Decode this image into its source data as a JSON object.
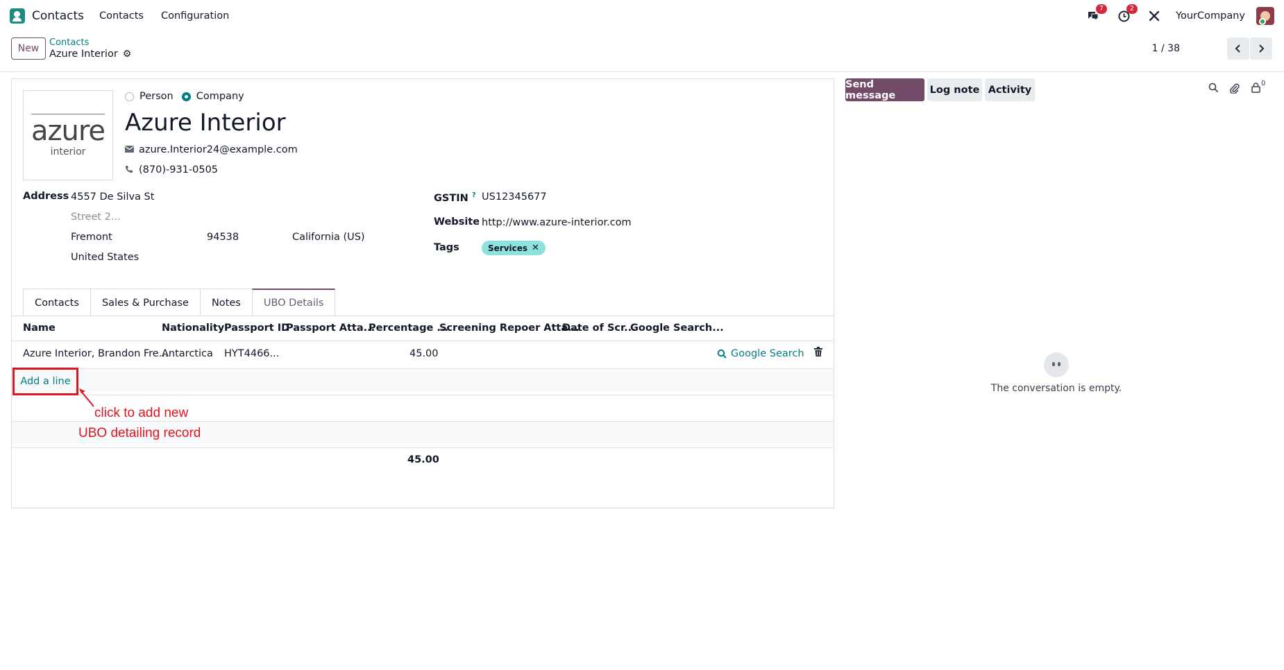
{
  "navbar": {
    "app_name": "Contacts",
    "menus": [
      "Contacts",
      "Configuration"
    ],
    "messages_count": "7",
    "activities_count": "2",
    "company": "YourCompany"
  },
  "control_panel": {
    "new_label": "New",
    "breadcrumb_parent": "Contacts",
    "breadcrumb_current": "Azure Interior",
    "pager": "1 / 38"
  },
  "partner": {
    "logo_word": "azure",
    "logo_sub": "interior",
    "type_options": [
      "Person",
      "Company"
    ],
    "selected_type": "Company",
    "name": "Azure Interior",
    "email": "azure.Interior24@example.com",
    "phone": "(870)-931-0505",
    "address_label": "Address",
    "street": "4557 De Silva St",
    "street2_placeholder": "Street 2...",
    "city": "Fremont",
    "zip": "94538",
    "state": "California (US)",
    "country": "United States",
    "gstin_label": "GSTIN",
    "gstin_help": "?",
    "gstin": "US12345677",
    "website_label": "Website",
    "website": "http://www.azure-interior.com",
    "tags_label": "Tags",
    "tags": [
      "Services"
    ]
  },
  "tabs": [
    "Contacts",
    "Sales & Purchase",
    "Notes",
    "UBO Details"
  ],
  "active_tab": "UBO Details",
  "ubo_table": {
    "columns": [
      "Name",
      "Nationality",
      "Passport ID",
      "Passport Atta...",
      "Percentage ...",
      "Screening Repoer Atta...",
      "Date of Scr...",
      "Google Search..."
    ],
    "rows": [
      {
        "name": "Azure Interior, Brandon Fre...",
        "nationality": "Antarctica",
        "passport_id": "HYT4466...",
        "percentage": "45.00",
        "google_search": "Google Search"
      }
    ],
    "add_line": "Add a line",
    "total_percentage": "45.00"
  },
  "annotation": {
    "line1": "click to add new",
    "line2": "UBO detailing record"
  },
  "chatter": {
    "send_message": "Send message",
    "log_note": "Log note",
    "activity": "Activity",
    "followers_count": "0",
    "empty_text": "The conversation is empty."
  },
  "colors": {
    "primary": "#714b67",
    "link": "#017e84",
    "annotation": "#e0141e",
    "tag_bg": "#8ee2dc"
  }
}
